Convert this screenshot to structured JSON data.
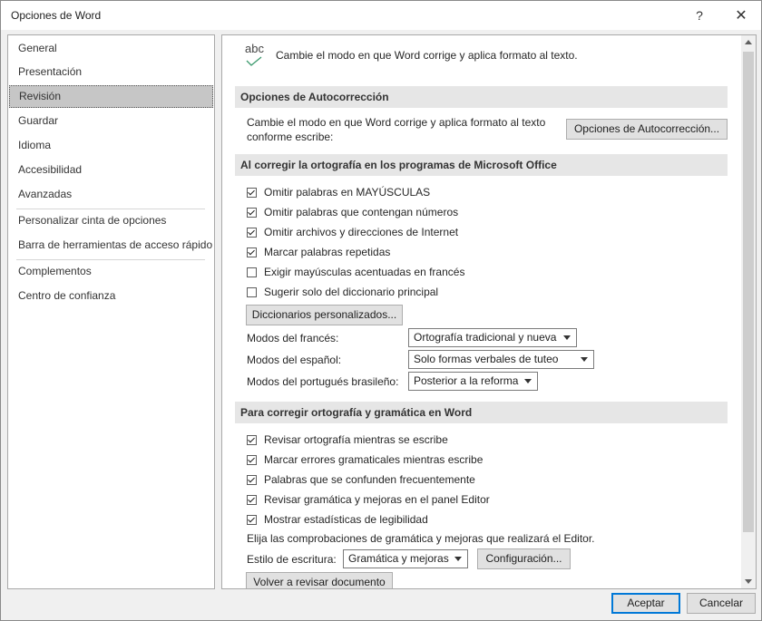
{
  "window": {
    "title": "Opciones de Word",
    "help_icon": "?",
    "close_icon": "✕"
  },
  "nav": {
    "items": [
      "General",
      "Presentación",
      "Revisión",
      "Guardar",
      "Idioma",
      "Accesibilidad",
      "Avanzadas",
      "Personalizar cinta de opciones",
      "Barra de herramientas de acceso rápido",
      "Complementos",
      "Centro de confianza"
    ],
    "selected": "Revisión"
  },
  "header": {
    "icon_text": "abc",
    "text": "Cambie el modo en que Word corrige y aplica formato al texto."
  },
  "autocorrect": {
    "title": "Opciones de Autocorrección",
    "desc_line1": "Cambie el modo en que Word corrige y aplica formato al texto",
    "desc_line2": "conforme escribe:",
    "button": "Opciones de Autocorrección..."
  },
  "office_spelling": {
    "title": "Al corregir la ortografía en los programas de Microsoft Office",
    "options": [
      {
        "label": "Omitir palabras en MAYÚSCULAS",
        "checked": true
      },
      {
        "label": "Omitir palabras que contengan números",
        "checked": true
      },
      {
        "label": "Omitir archivos y direcciones de Internet",
        "checked": true
      },
      {
        "label": "Marcar palabras repetidas",
        "checked": true
      },
      {
        "label": "Exigir mayúsculas acentuadas en francés",
        "checked": false
      },
      {
        "label": "Sugerir solo del diccionario principal",
        "checked": false
      }
    ],
    "dict_button": "Diccionarios personalizados...",
    "french_label": "Modos del francés:",
    "french_value": "Ortografía tradicional y nueva",
    "spanish_label": "Modos del español:",
    "spanish_value": "Solo formas verbales de tuteo",
    "portuguese_label": "Modos del portugués brasileño:",
    "portuguese_value": "Posterior a la reforma"
  },
  "word_spelling": {
    "title": "Para corregir ortografía y gramática en Word",
    "options": [
      {
        "label": "Revisar ortografía mientras se escribe",
        "checked": true
      },
      {
        "label": "Marcar errores gramaticales mientras escribe",
        "checked": true
      },
      {
        "label": "Palabras que se confunden frecuentemente",
        "checked": true
      },
      {
        "label": "Revisar gramática y mejoras en el panel Editor",
        "checked": true
      },
      {
        "label": "Mostrar estadísticas de legibilidad",
        "checked": true
      }
    ],
    "editor_text": "Elija las comprobaciones de gramática y mejoras que realizará el Editor.",
    "style_label": "Estilo de escritura:",
    "style_value": "Gramática y mejoras",
    "config_button": "Configuración...",
    "recheck_button": "Volver a revisar documento"
  },
  "footer": {
    "ok": "Aceptar",
    "cancel": "Cancelar"
  },
  "colors": {
    "accent": "#0078d7",
    "selected_nav": "#c6c6c6",
    "section_bg": "#e6e6e6",
    "check_icon": "#3c9a6e"
  }
}
